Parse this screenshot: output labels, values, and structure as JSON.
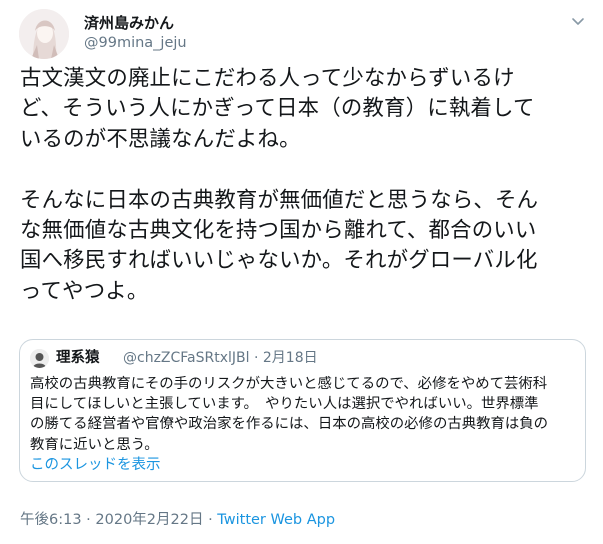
{
  "author": {
    "display_name": "済州島みかん",
    "handle": "@99mina_jeju"
  },
  "tweet": {
    "text": "古文漢文の廃止にこだわる人って少なからずいるけ\nど、そういう人にかぎって日本（の教育）に執着して\nいるのが不思議なんだよね。\n\nそんなに日本の古典教育が無価値だと思うなら、そん\nな無価値な古典文化を持つ国から離れて、都合のいい\n国へ移民すればいいじゃないか。それがグローバル化\nってやつよ。"
  },
  "quoted": {
    "display_name": "理系猿",
    "handle_date": "@chzZCFaSRtxlJBl · 2月18日",
    "text": "高校の古典教育にその手のリスクが大きいと感じてるので、必修をやめて芸術科\n目にしてほしいと主張しています。　やりたい人は選択でやればいい。世界標準\nの勝てる経営者や官僚や政治家を作るには、日本の高校の必修の古典教育は負の\n教育に近いと思う。",
    "thread_link": "このスレッドを表示"
  },
  "footer": {
    "timestamp": "午後6:13 · 2020年2月22日",
    "separator": " · ",
    "app": "Twitter Web App"
  },
  "icons": {
    "avatar": "avatar-illustration",
    "caret": "chevron-down-icon",
    "quoted_avatar": "avatar-illustration"
  },
  "colors": {
    "text": "#14171a",
    "secondary": "#657786",
    "link": "#1b95e0",
    "border": "#ccd6dd"
  }
}
